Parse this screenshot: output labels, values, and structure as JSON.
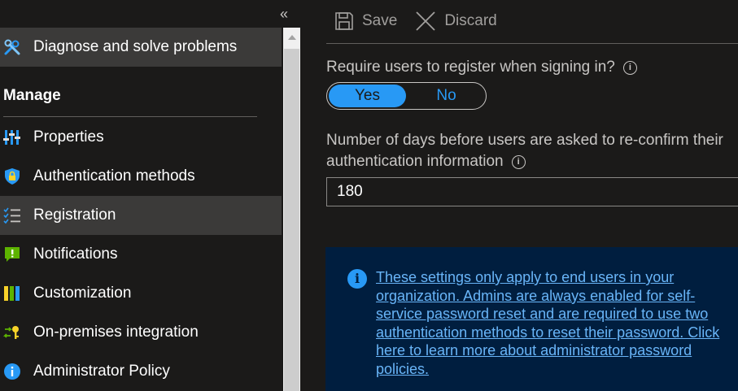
{
  "sidebar": {
    "collapse_glyph": "«",
    "top_item": "Diagnose and solve problems",
    "section_title": "Manage",
    "items": [
      {
        "label": "Properties",
        "icon": "properties-icon"
      },
      {
        "label": "Authentication methods",
        "icon": "shield-lock-icon"
      },
      {
        "label": "Registration",
        "icon": "checklist-icon",
        "selected": true
      },
      {
        "label": "Notifications",
        "icon": "notification-icon"
      },
      {
        "label": "Customization",
        "icon": "customization-icon"
      },
      {
        "label": "On-premises integration",
        "icon": "sync-key-icon"
      },
      {
        "label": "Administrator Policy",
        "icon": "info-icon"
      }
    ]
  },
  "toolbar": {
    "save_label": "Save",
    "discard_label": "Discard"
  },
  "form": {
    "require_label": "Require users to register when signing in?",
    "toggle": {
      "yes": "Yes",
      "no": "No",
      "selected": "Yes"
    },
    "days_label_line1": "Number of days before users are asked to re-confirm their",
    "days_label_line2": "authentication information",
    "days_value": "180"
  },
  "info": {
    "text": "These settings only apply to end users in your organization. Admins are always enabled for self-service password reset and are required to use two authentication methods to reset their password. Click here to learn more about administrator password policies."
  },
  "colors": {
    "accent": "#2899f5",
    "info_bg": "#001e3f",
    "selected_bg": "#3b3a39"
  }
}
